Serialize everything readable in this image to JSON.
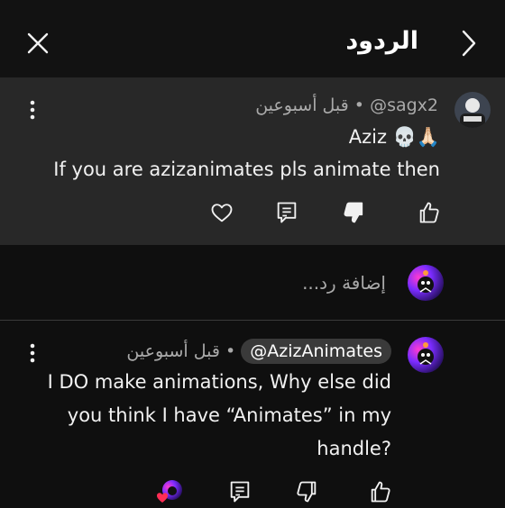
{
  "header": {
    "title": "الردود"
  },
  "parent_comment": {
    "author": "@sagx2",
    "time": "قبل أسبوعين",
    "separator": "•",
    "lines": [
      "Aziz 💀🙏🏻",
      "If you are azizanimates pls animate then"
    ],
    "actions": [
      "like-icon",
      "dislike-icon",
      "reply-icon",
      "heart-icon"
    ]
  },
  "add_reply": {
    "placeholder": "إضافة رد..."
  },
  "reply": {
    "mention": "@AzizAnimates",
    "time": "قبل أسبوعين",
    "separator": "•",
    "lines": [
      "I DO make animations, Why else did",
      "you think I have “Animates” in my",
      "handle?"
    ],
    "actions": [
      "like-icon",
      "dislike-icon",
      "reply-icon",
      "creator-heart-icon"
    ]
  },
  "colors": {
    "background": "#0f0f0f",
    "parent_highlight": "#282828",
    "meta_text": "#aaaaaa",
    "mention_pill": "#3a3a3a"
  }
}
